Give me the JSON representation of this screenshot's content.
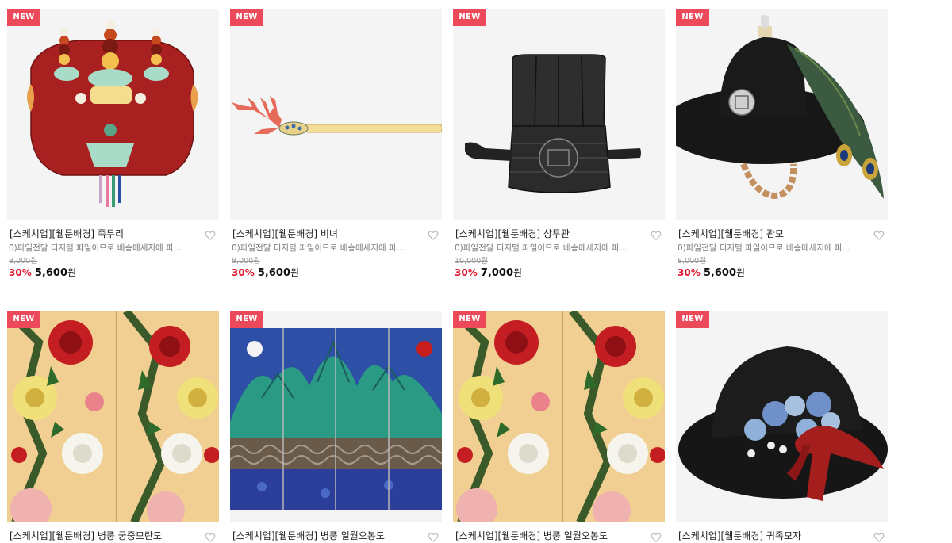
{
  "products": [
    {
      "badge": "NEW",
      "title": "[스케치업][웹툰배경] 족두리",
      "desc": "0)파일전달 디지털 파일이므로 배송메세지에 파...",
      "original_price": "8,000원",
      "discount": "30%",
      "price": "5,600",
      "currency": "원",
      "image": "jokduri"
    },
    {
      "badge": "NEW",
      "title": "[스케치업][웹툰배경] 비녀",
      "desc": "0)파일전달 디지털 파일이므로 배송메세지에 파...",
      "original_price": "8,000원",
      "discount": "30%",
      "price": "5,600",
      "currency": "원",
      "image": "binyeo"
    },
    {
      "badge": "NEW",
      "title": "[스케치업][웹툰배경] 상투관",
      "desc": "0)파일전달 디지털 파일이므로 배송메세지에 파...",
      "original_price": "10,000원",
      "discount": "30%",
      "price": "7,000",
      "currency": "원",
      "image": "sangtugwan"
    },
    {
      "badge": "NEW",
      "title": "[스케치업][웹툰배경] 관모",
      "desc": "0)파일전달 디지털 파일이므로 배송메세지에 파...",
      "original_price": "8,000원",
      "discount": "30%",
      "price": "5,600",
      "currency": "원",
      "image": "gwanmo"
    },
    {
      "badge": "NEW",
      "title": "[스케치업][웹툰배경] 병풍 궁중모란도",
      "image": "peony-screen"
    },
    {
      "badge": "NEW",
      "title": "[스케치업][웹툰배경] 병풍 일월오봉도",
      "image": "sun-moon-screen"
    },
    {
      "badge": "NEW",
      "title": "[스케치업][웹툰배경] 병풍 일월오봉도",
      "image": "peony-screen"
    },
    {
      "badge": "NEW",
      "title": "[스케치업][웹툰배경] 귀족모자",
      "image": "noble-hat"
    }
  ],
  "icons": {
    "wishlist": "heart-outline-icon"
  },
  "colors": {
    "badge": "#ec4a5a",
    "discount": "#e0152c"
  }
}
